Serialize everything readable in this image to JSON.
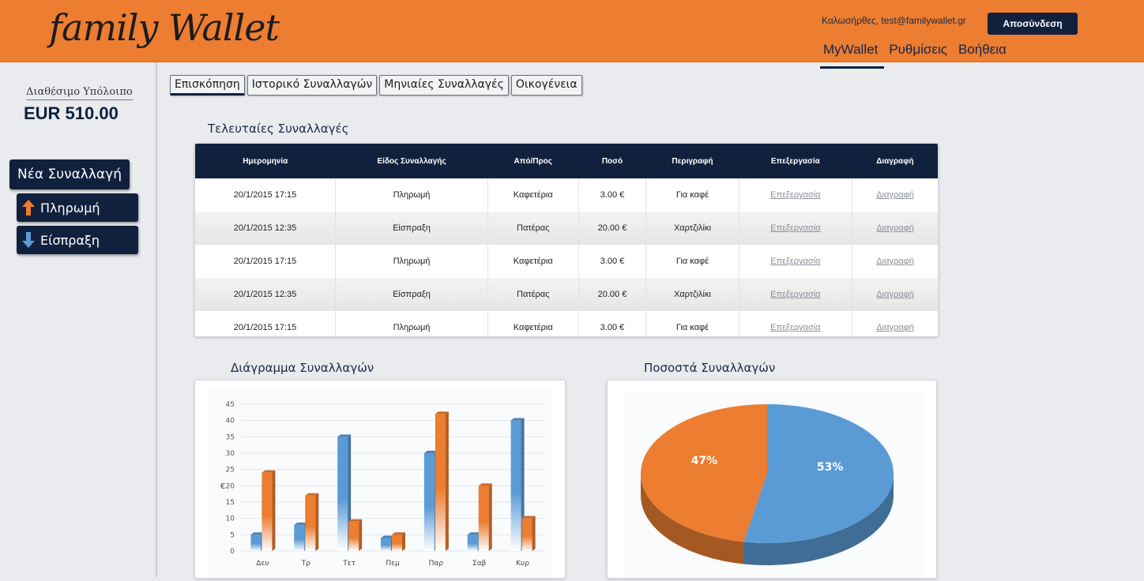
{
  "header": {
    "logo": "family Wallet",
    "greeting": "Καλωσήρθες, test@familywallet.gr",
    "logout_label": "Αποσύνδεση",
    "nav": [
      {
        "label": "MyWallet",
        "active": true
      },
      {
        "label": "Ρυθμίσεις",
        "active": false
      },
      {
        "label": "Βοήθεια",
        "active": false
      }
    ]
  },
  "sidebar": {
    "balance_label": "Διαθέσιμο Υπόλοιπο",
    "balance_value": "EUR 510.00",
    "new_transaction_label": "Νέα Συναλλαγή",
    "payment_label": "Πληρωμή",
    "income_label": "Είσπραξη",
    "payment_icon": "arrow-up-icon",
    "income_icon": "arrow-down-icon"
  },
  "tabs": [
    {
      "label": "Επισκόπηση",
      "active": true
    },
    {
      "label": "Ιστορικό Συναλλαγών",
      "active": false
    },
    {
      "label": "Μηνιαίες Συναλλαγές",
      "active": false
    },
    {
      "label": "Οικογένεια",
      "active": false
    }
  ],
  "recent": {
    "title": "Τελευταίες Συναλλαγές",
    "columns": [
      "Ημερομηνία",
      "Είδος Συναλλαγής",
      "Από/Προς",
      "Ποσό",
      "Περιγραφή",
      "Επεξεργασία",
      "Διαγραφή"
    ],
    "rows": [
      [
        "20/1/2015 17:15",
        "Πληρωμή",
        "Καφετέρια",
        "3.00 €",
        "Για καφέ",
        "Επεξεργασία",
        "Διαγραφή"
      ],
      [
        "20/1/2015 12:35",
        "Είσπραξη",
        "Πατέρας",
        "20.00 €",
        "Χαρτζιλίκι",
        "Επεξεργασία",
        "Διαγραφή"
      ],
      [
        "20/1/2015 17:15",
        "Πληρωμή",
        "Καφετέρια",
        "3.00 €",
        "Για καφέ",
        "Επεξεργασία",
        "Διαγραφή"
      ],
      [
        "20/1/2015 12:35",
        "Είσπραξη",
        "Πατέρας",
        "20.00 €",
        "Χαρτζιλίκι",
        "Επεξεργασία",
        "Διαγραφή"
      ],
      [
        "20/1/2015 17:15",
        "Πληρωμή",
        "Καφετέρια",
        "3.00 €",
        "Για καφέ",
        "Επεξεργασία",
        "Διαγραφή"
      ]
    ]
  },
  "bar_section_title": "Διάγραμμα Συναλλαγών",
  "pie_section_title": "Ποσοστά Συναλλαγών",
  "colors": {
    "orange": "#ec7d31",
    "navy": "#11213d",
    "blue": "#5b9bd5",
    "link_gray": "#8a8f98"
  },
  "chart_data": [
    {
      "type": "bar",
      "categories": [
        "Δευ",
        "Τρ",
        "Τετ",
        "Πεμ",
        "Παρ",
        "Σαβ",
        "Κυρ"
      ],
      "series": [
        {
          "values": [
            5,
            8,
            35,
            4,
            30,
            5,
            40
          ],
          "color": "#5b9bd5"
        },
        {
          "values": [
            24,
            17,
            9,
            5,
            42,
            20,
            10
          ],
          "color": "#ec7d31"
        }
      ],
      "ylabel": "€",
      "ylim": [
        0,
        45
      ],
      "yticks": [
        0,
        5,
        10,
        15,
        20,
        25,
        30,
        35,
        40,
        45
      ],
      "grid": true
    },
    {
      "type": "pie",
      "slices": [
        {
          "label": "47%",
          "value": 47,
          "color": "#ec7d31"
        },
        {
          "label": "53%",
          "value": 53,
          "color": "#5b9bd5"
        }
      ]
    }
  ]
}
